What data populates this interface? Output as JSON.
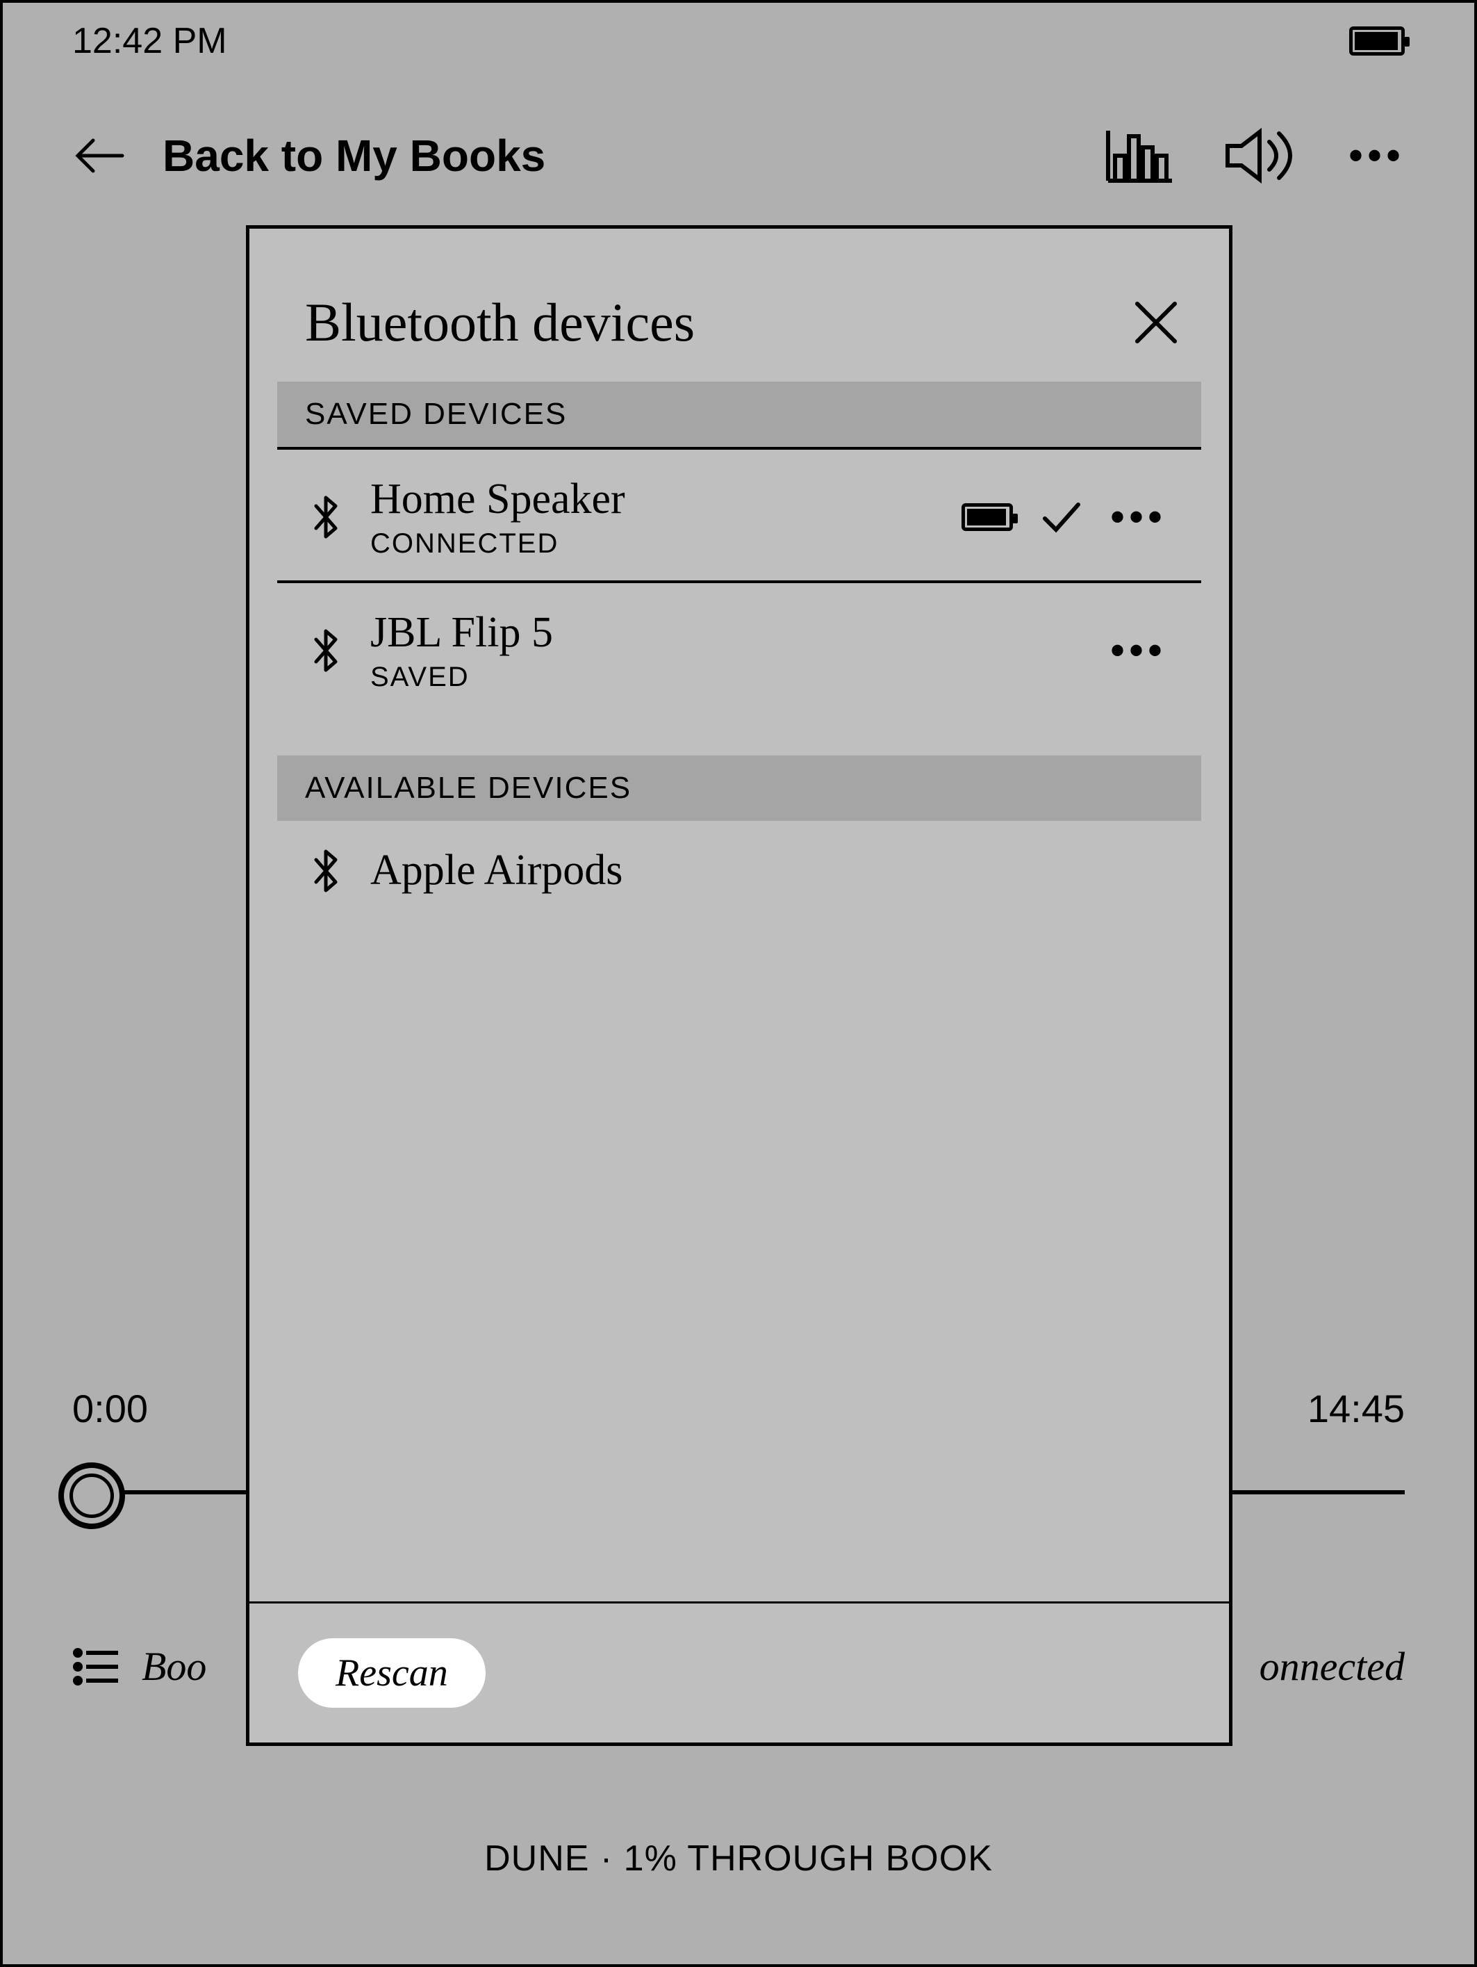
{
  "status": {
    "time": "12:42 PM"
  },
  "nav": {
    "back_label": "Back to My Books"
  },
  "player": {
    "elapsed": "0:00",
    "remaining": "14:45",
    "chapter_label_partial_left": "Boo",
    "right_partial": "onnected"
  },
  "progress_caption": "DUNE · 1% THROUGH BOOK",
  "modal": {
    "title": "Bluetooth devices",
    "saved_header": "SAVED DEVICES",
    "available_header": "AVAILABLE DEVICES",
    "rescan_label": "Rescan",
    "saved_devices": [
      {
        "name": "Home Speaker",
        "status": "CONNECTED",
        "connected": true
      },
      {
        "name": "JBL Flip 5",
        "status": "SAVED",
        "connected": false
      }
    ],
    "available_devices": [
      {
        "name": "Apple Airpods"
      }
    ]
  }
}
